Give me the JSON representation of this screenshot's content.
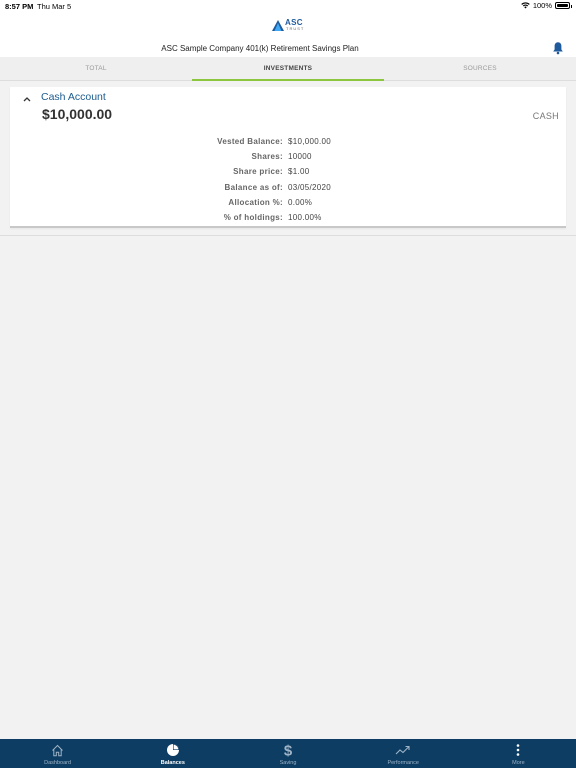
{
  "status_bar": {
    "time": "8:57 PM",
    "date": "Thu Mar 5",
    "battery": "100%"
  },
  "header": {
    "logo_main": "ASC",
    "logo_sub": "TRUST",
    "plan_title": "ASC Sample Company 401(k) Retirement Savings Plan"
  },
  "tabs": [
    {
      "label": "TOTAL"
    },
    {
      "label": "INVESTMENTS"
    },
    {
      "label": "SOURCES"
    }
  ],
  "account": {
    "name": "Cash Account",
    "amount": "$10,000.00",
    "type": "CASH",
    "details": [
      {
        "label": "Vested Balance:",
        "value": "$10,000.00"
      },
      {
        "label": "Shares:",
        "value": "10000"
      },
      {
        "label": "Share price:",
        "value": "$1.00"
      },
      {
        "label": "Balance as of:",
        "value": "03/05/2020"
      },
      {
        "label": "Allocation %:",
        "value": "0.00%"
      },
      {
        "label": "% of holdings:",
        "value": "100.00%"
      }
    ]
  },
  "bottom_nav": [
    {
      "label": "Dashboard",
      "icon": "home-icon"
    },
    {
      "label": "Balances",
      "icon": "pie-chart-icon"
    },
    {
      "label": "Saving",
      "icon": "dollar-icon"
    },
    {
      "label": "Performance",
      "icon": "trend-up-icon"
    },
    {
      "label": "More",
      "icon": "more-vertical-icon"
    }
  ],
  "colors": {
    "accent_green": "#8cc63f",
    "link_blue": "#1b5b8f",
    "nav_background": "#0d3d63",
    "bell_blue": "#1f5a9c"
  }
}
